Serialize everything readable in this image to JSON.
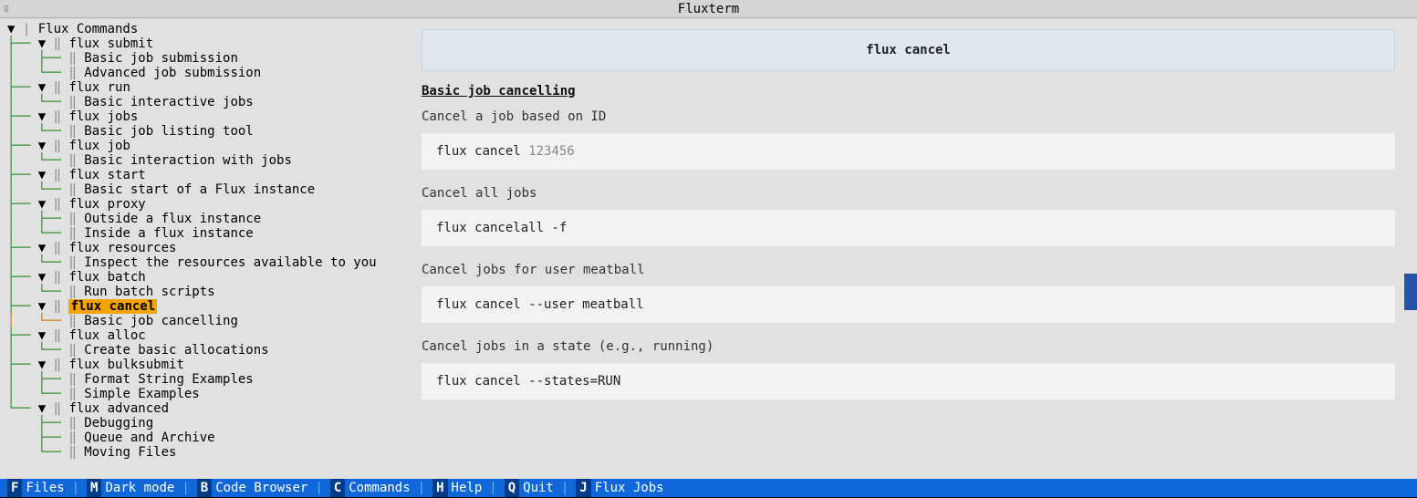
{
  "title": "Fluxterm",
  "tree_root": "Flux Commands",
  "tree": [
    {
      "label": "flux submit",
      "children": [
        "Basic job submission",
        "Advanced job submission"
      ]
    },
    {
      "label": "flux run",
      "children": [
        "Basic interactive jobs"
      ]
    },
    {
      "label": "flux jobs",
      "children": [
        "Basic job listing tool"
      ]
    },
    {
      "label": "flux job",
      "children": [
        "Basic interaction with jobs"
      ]
    },
    {
      "label": "flux start",
      "children": [
        "Basic start of a Flux instance"
      ]
    },
    {
      "label": "flux proxy",
      "children": [
        "Outside a flux instance",
        "Inside a flux instance"
      ]
    },
    {
      "label": "flux resources",
      "children": [
        "Inspect the resources available to you"
      ]
    },
    {
      "label": "flux batch",
      "children": [
        "Run batch scripts"
      ]
    },
    {
      "label": "flux cancel",
      "children": [
        "Basic job cancelling"
      ],
      "selected": true
    },
    {
      "label": "flux alloc",
      "children": [
        "Create basic allocations"
      ]
    },
    {
      "label": "flux bulksubmit",
      "children": [
        "Format String Examples",
        "Simple Examples"
      ]
    },
    {
      "label": "flux advanced",
      "children": [
        "Debugging",
        "Queue and Archive",
        "Moving Files"
      ]
    }
  ],
  "content": {
    "header": "flux cancel",
    "section_title": "Basic job cancelling",
    "blocks": [
      {
        "desc": "Cancel a job based on ID",
        "cmd": "flux cancel ",
        "arg": "123456"
      },
      {
        "desc": "Cancel all jobs",
        "cmd": "flux cancelall -f",
        "arg": ""
      },
      {
        "desc": "Cancel jobs for user meatball",
        "cmd": "flux cancel --user meatball",
        "arg": ""
      },
      {
        "desc": "Cancel jobs in a state (e.g., running)",
        "cmd": "flux cancel --states=RUN",
        "arg": ""
      }
    ]
  },
  "statusbar": [
    {
      "key": "F",
      "label": "Files"
    },
    {
      "key": "M",
      "label": "Dark mode"
    },
    {
      "key": "B",
      "label": "Code Browser"
    },
    {
      "key": "C",
      "label": "Commands"
    },
    {
      "key": "H",
      "label": "Help"
    },
    {
      "key": "Q",
      "label": "Quit"
    },
    {
      "key": "J",
      "label": "Flux Jobs"
    }
  ]
}
